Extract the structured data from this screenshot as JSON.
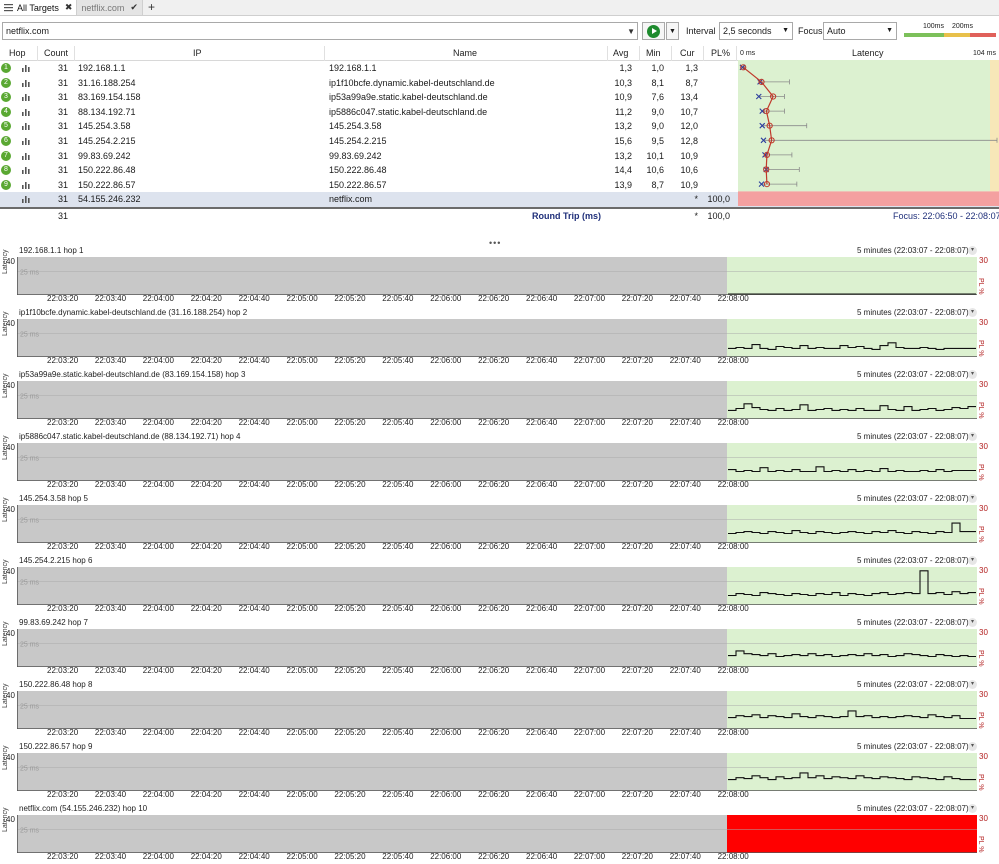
{
  "tabs": [
    {
      "label": "All Targets",
      "state": "active"
    },
    {
      "label": "netflix.com",
      "state": "inactive"
    }
  ],
  "toolbar": {
    "target": "netflix.com",
    "interval_label": "Interval",
    "interval_value": "2,5 seconds",
    "focus_label": "Focus",
    "focus_value": "Auto",
    "scale_100": "100ms",
    "scale_200": "200ms"
  },
  "table": {
    "headers": {
      "hop": "Hop",
      "count": "Count",
      "ip": "IP",
      "name": "Name",
      "avg": "Avg",
      "min": "Min",
      "cur": "Cur",
      "pl": "PL%",
      "latency_min": "0 ms",
      "latency": "Latency",
      "latency_max": "104 ms"
    },
    "rows": [
      {
        "hop": "1",
        "count": "31",
        "ip": "192.168.1.1",
        "name": "192.168.1.1",
        "avg": "1,3",
        "min": "1,0",
        "cur": "1,3",
        "pl": "",
        "avg_ms": 1.3,
        "min_ms": 1.0,
        "cur_ms": 1.3,
        "max_ms": 2.0
      },
      {
        "hop": "2",
        "count": "31",
        "ip": "31.16.188.254",
        "name": "ip1f10bcfe.dynamic.kabel-deutschland.de",
        "avg": "10,3",
        "min": "8,1",
        "cur": "8,7",
        "pl": "",
        "avg_ms": 10.3,
        "min_ms": 8.1,
        "cur_ms": 8.7,
        "max_ms": 20.0
      },
      {
        "hop": "3",
        "count": "31",
        "ip": "83.169.154.158",
        "name": "ip53a99a9e.static.kabel-deutschland.de",
        "avg": "10,9",
        "min": "7,6",
        "cur": "13,4",
        "pl": "",
        "avg_ms": 10.9,
        "min_ms": 7.6,
        "cur_ms": 13.4,
        "max_ms": 18.0
      },
      {
        "hop": "4",
        "count": "31",
        "ip": "88.134.192.71",
        "name": "ip5886c047.static.kabel-deutschland.de",
        "avg": "11,2",
        "min": "9,0",
        "cur": "10,7",
        "pl": "",
        "avg_ms": 11.2,
        "min_ms": 9.0,
        "cur_ms": 10.7,
        "max_ms": 18.0
      },
      {
        "hop": "5",
        "count": "31",
        "ip": "145.254.3.58",
        "name": "145.254.3.58",
        "avg": "13,2",
        "min": "9,0",
        "cur": "12,0",
        "pl": "",
        "avg_ms": 13.2,
        "min_ms": 9.0,
        "cur_ms": 12.0,
        "max_ms": 27.0
      },
      {
        "hop": "6",
        "count": "31",
        "ip": "145.254.2.215",
        "name": "145.254.2.215",
        "avg": "15,6",
        "min": "9,5",
        "cur": "12,8",
        "pl": "",
        "avg_ms": 15.6,
        "min_ms": 9.5,
        "cur_ms": 12.8,
        "max_ms": 104.0
      },
      {
        "hop": "7",
        "count": "31",
        "ip": "99.83.69.242",
        "name": "99.83.69.242",
        "avg": "13,2",
        "min": "10,1",
        "cur": "10,9",
        "pl": "",
        "avg_ms": 13.2,
        "min_ms": 10.1,
        "cur_ms": 10.9,
        "max_ms": 21.0
      },
      {
        "hop": "8",
        "count": "31",
        "ip": "150.222.86.48",
        "name": "150.222.86.48",
        "avg": "14,4",
        "min": "10,6",
        "cur": "10,6",
        "pl": "",
        "avg_ms": 14.4,
        "min_ms": 10.6,
        "cur_ms": 10.6,
        "max_ms": 24.0
      },
      {
        "hop": "9",
        "count": "31",
        "ip": "150.222.86.57",
        "name": "150.222.86.57",
        "avg": "13,9",
        "min": "8,7",
        "cur": "10,9",
        "pl": "",
        "avg_ms": 13.9,
        "min_ms": 8.7,
        "cur_ms": 10.9,
        "max_ms": 23.0
      }
    ],
    "destination": {
      "count": "31",
      "ip": "54.155.246.232",
      "name": "netflix.com",
      "star": "*",
      "pl": "100,0"
    },
    "summary": {
      "count": "31",
      "label": "Round Trip (ms)",
      "star": "*",
      "pl": "100,0",
      "focus": "Focus: 22:06:50 - 22:08:07"
    }
  },
  "charts": {
    "range_label": "5 minutes (22:03:07 - 22:08:07)",
    "y_max": "40",
    "y_axis_label": "Latency",
    "pl_max": "30",
    "pl_label": "PL %",
    "ref_label": "25 ms",
    "x_ticks": [
      "22:03:20",
      "22:03:40",
      "22:04:00",
      "22:04:20",
      "22:04:40",
      "22:05:00",
      "22:05:20",
      "22:05:40",
      "22:06:00",
      "22:06:20",
      "22:06:40",
      "22:07:00",
      "22:07:20",
      "22:07:40",
      "22:08:00"
    ],
    "items": [
      {
        "title": "192.168.1.1 hop 1",
        "lost": false,
        "samples": [
          1,
          1,
          1,
          1,
          1,
          1,
          1,
          1,
          1,
          1,
          1,
          1,
          1,
          1,
          1,
          1,
          1,
          1,
          1,
          1,
          1,
          1,
          1,
          1,
          1,
          1,
          1,
          1,
          1,
          1,
          1
        ]
      },
      {
        "title": "ip1f10bcfe.dynamic.kabel-deutschland.de (31.16.188.254) hop 2",
        "lost": false,
        "samples": [
          9,
          10,
          9,
          13,
          9,
          8,
          11,
          10,
          9,
          12,
          9,
          10,
          9,
          9,
          12,
          10,
          11,
          9,
          8,
          12,
          15,
          10,
          9,
          9,
          10,
          9,
          8,
          9,
          9,
          9,
          9
        ]
      },
      {
        "title": "ip53a99a9e.static.kabel-deutschland.de (83.169.154.158) hop 3",
        "lost": false,
        "samples": [
          9,
          11,
          16,
          12,
          10,
          9,
          11,
          9,
          10,
          15,
          9,
          10,
          11,
          9,
          10,
          9,
          11,
          9,
          9,
          14,
          10,
          9,
          13,
          9,
          10,
          11,
          9,
          10,
          12,
          11,
          13
        ]
      },
      {
        "title": "ip5886c047.static.kabel-deutschland.de (88.134.192.71) hop 4",
        "lost": false,
        "samples": [
          12,
          10,
          11,
          10,
          14,
          10,
          11,
          10,
          12,
          10,
          10,
          15,
          10,
          11,
          10,
          12,
          10,
          11,
          10,
          13,
          10,
          11,
          10,
          10,
          11,
          10,
          12,
          10,
          11,
          11,
          11
        ]
      },
      {
        "title": "145.254.3.58 hop 5",
        "lost": false,
        "samples": [
          10,
          11,
          12,
          11,
          10,
          12,
          11,
          10,
          13,
          11,
          10,
          12,
          11,
          10,
          11,
          12,
          11,
          10,
          12,
          11,
          13,
          11,
          10,
          12,
          11,
          10,
          12,
          11,
          21,
          12,
          12
        ]
      },
      {
        "title": "145.254.2.215 hop 6",
        "lost": false,
        "samples": [
          10,
          12,
          11,
          10,
          13,
          12,
          11,
          10,
          12,
          11,
          10,
          12,
          11,
          13,
          10,
          12,
          11,
          10,
          12,
          13,
          11,
          12,
          13,
          12,
          36,
          12,
          13,
          11,
          14,
          12,
          13
        ]
      },
      {
        "title": "99.83.69.242 hop 7",
        "lost": false,
        "samples": [
          12,
          17,
          14,
          13,
          12,
          14,
          11,
          12,
          13,
          12,
          14,
          12,
          13,
          11,
          12,
          13,
          12,
          14,
          12,
          13,
          11,
          12,
          14,
          13,
          12,
          11,
          13,
          12,
          11,
          12,
          11
        ]
      },
      {
        "title": "150.222.86.48 hop 8",
        "lost": false,
        "samples": [
          12,
          14,
          13,
          15,
          12,
          14,
          13,
          12,
          16,
          13,
          12,
          14,
          13,
          12,
          13,
          19,
          13,
          14,
          12,
          13,
          12,
          13,
          14,
          13,
          12,
          15,
          13,
          12,
          14,
          11,
          11
        ]
      },
      {
        "title": "150.222.86.57 hop 9",
        "lost": false,
        "samples": [
          12,
          14,
          13,
          16,
          14,
          12,
          15,
          13,
          14,
          19,
          14,
          16,
          13,
          15,
          14,
          13,
          16,
          14,
          13,
          15,
          14,
          13,
          12,
          15,
          14,
          13,
          12,
          15,
          13,
          12,
          12
        ]
      },
      {
        "title": "netflix.com (54.155.246.232) hop 10",
        "lost": true,
        "samples": []
      }
    ]
  },
  "colors": {
    "hop_green": "#5aa832",
    "focus_green": "#dcf1d0",
    "loss_red": "#ff0000",
    "history_gray": "#c8c8c8",
    "dest_row": "#dde3ee",
    "latency_line": "#c0392b",
    "range_bar_blue": "#2c3e9e"
  }
}
